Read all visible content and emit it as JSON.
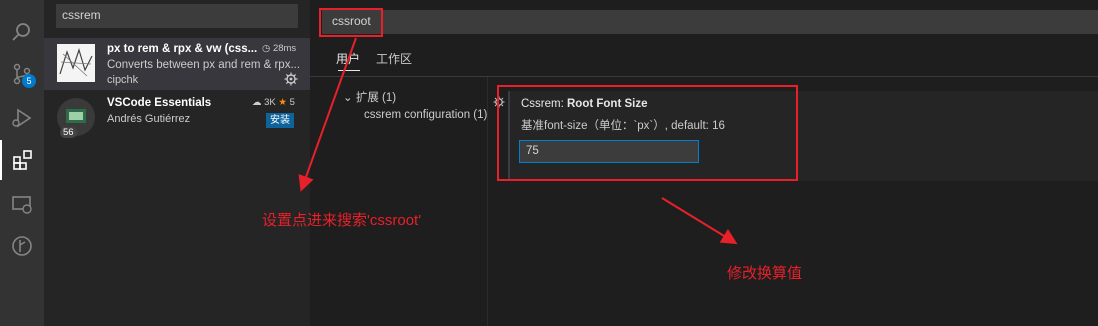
{
  "activity_bar": {
    "icons": [
      "search-icon",
      "source-control-icon",
      "run-debug-icon",
      "extensions-icon",
      "remote-explorer-icon",
      "git-graph-icon"
    ],
    "scm_badge": "5",
    "active_color": "#ffffff"
  },
  "extensions_search": {
    "value": "cssrem"
  },
  "extensions": [
    {
      "name": "px to rem & rpx & vw (css...",
      "description": "Converts between px and rem & rpx...",
      "author": "cipchk",
      "time": "28ms"
    },
    {
      "name": "VSCode Essentials",
      "author": "Andrés Gutiérrez",
      "downloads": "3K",
      "rating": "5",
      "thumb_badge": "56",
      "install_label": "安装"
    }
  ],
  "settings": {
    "search_value": "cssroot",
    "tabs": [
      "用户",
      "工作区"
    ],
    "toc_group": "扩展 (1)",
    "toc_item": "cssrem configuration (1)",
    "setting_title_prefix": "Cssrem: ",
    "setting_title_name": "Root Font Size",
    "setting_description": "基准font-size（单位：`px`）, default: 16",
    "setting_value": "75"
  },
  "annotations": {
    "search_note": "设置点进来搜索'cssroot'",
    "value_note": "修改换算值",
    "color": "#e8202a"
  },
  "colors": {
    "accent": "#007acc",
    "install_button": "#0e639c",
    "annotation": "#e8202a"
  }
}
